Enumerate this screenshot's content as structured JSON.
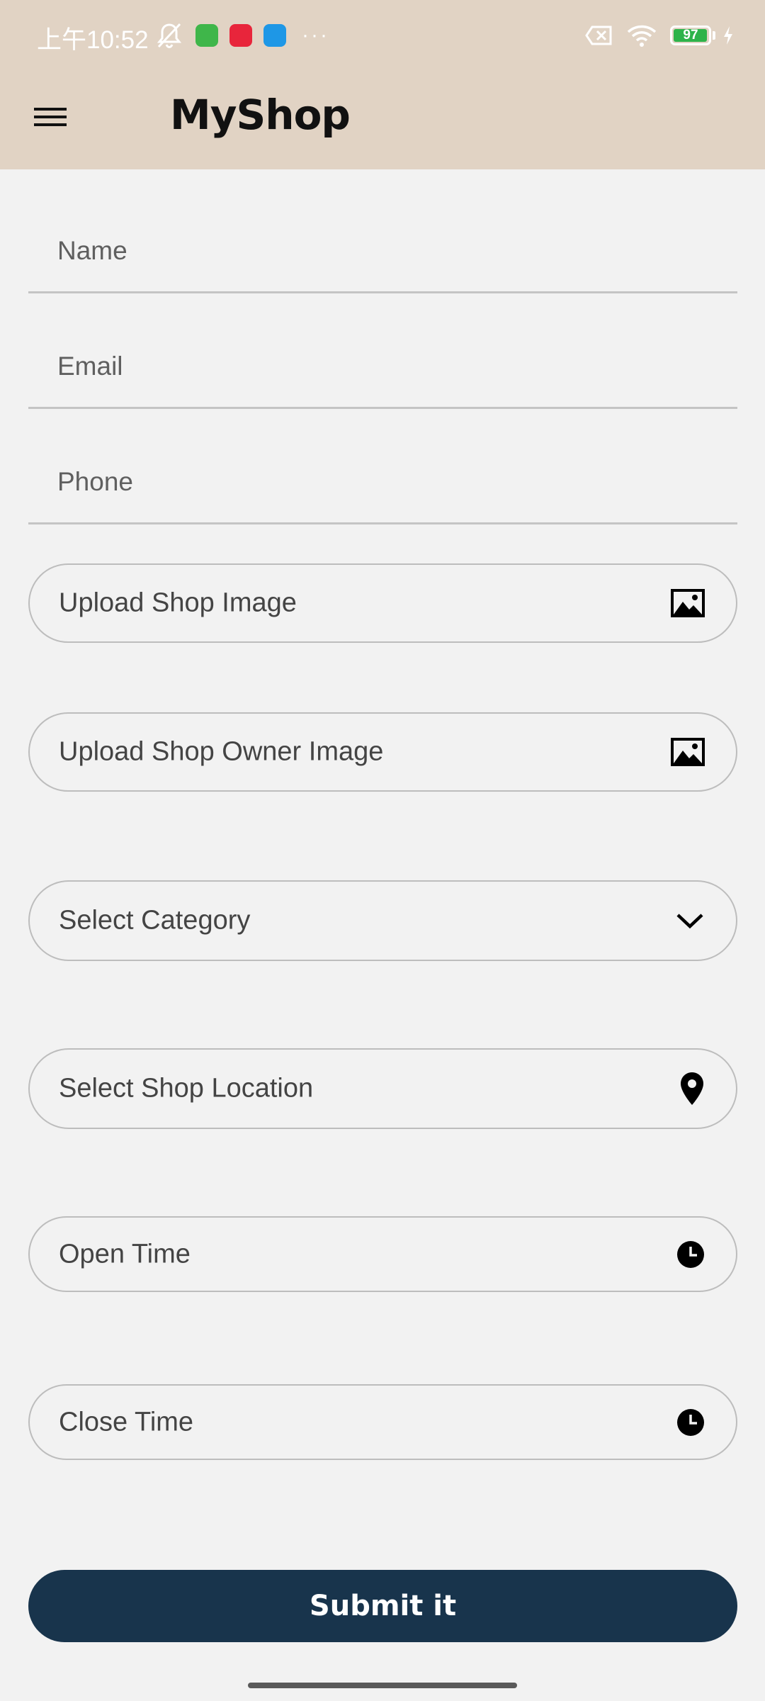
{
  "status_bar": {
    "time": "上午10:52",
    "battery_level": "97",
    "battery_fraction": 0.97,
    "icons": [
      "mute-icon",
      "wechat-app-icon",
      "xiaohongshu-app-icon",
      "blue-app-icon",
      "more-icon",
      "no-sim-icon",
      "wifi-icon",
      "battery-icon",
      "charging-icon"
    ],
    "more_text": "···"
  },
  "app_bar": {
    "title": "MyShop",
    "menu_icon": "hamburger-menu-icon",
    "background_color": "#e1d3c4"
  },
  "form": {
    "name": {
      "value": "",
      "placeholder": "Name"
    },
    "email": {
      "value": "",
      "placeholder": "Email"
    },
    "phone": {
      "value": "",
      "placeholder": "Phone"
    },
    "upload_shop_image": {
      "label": "Upload Shop Image",
      "icon": "image-icon"
    },
    "upload_owner_image": {
      "label": "Upload Shop Owner Image",
      "icon": "image-icon"
    },
    "category": {
      "label": "Select Category",
      "icon": "chevron-down-icon"
    },
    "location": {
      "label": "Select Shop Location",
      "icon": "location-pin-icon"
    },
    "open_time": {
      "label": "Open Time",
      "icon": "clock-icon"
    },
    "close_time": {
      "label": "Close Time",
      "icon": "clock-icon"
    }
  },
  "submit": {
    "label": "Submit it",
    "color": "#18344c"
  }
}
